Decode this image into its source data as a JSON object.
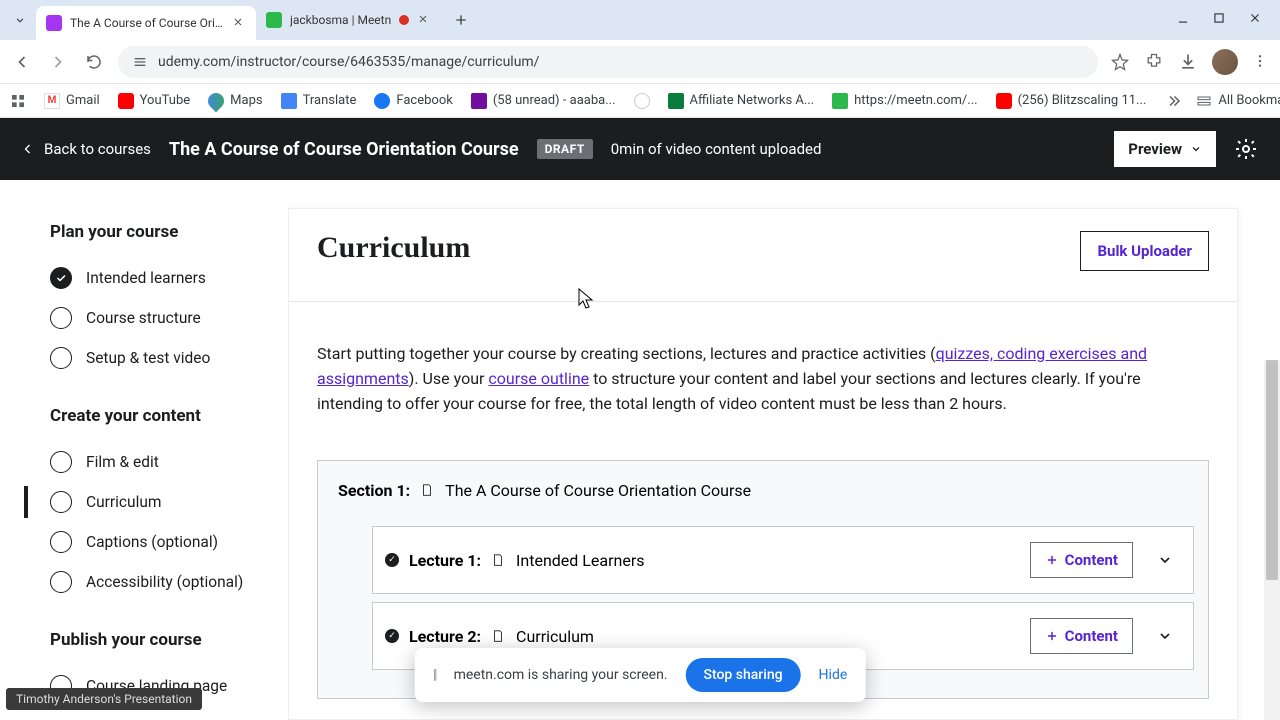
{
  "browser": {
    "tabs": [
      {
        "title": "The A Course of Course Orienta",
        "favicon_color": "#a435f0"
      },
      {
        "title": "jackbosma | Meetn",
        "favicon_color": "#2db84c"
      }
    ],
    "url": "udemy.com/instructor/course/6463535/manage/curriculum/"
  },
  "bookmarks": {
    "items": [
      {
        "label": "Gmail",
        "icon_bg": "#ea4335"
      },
      {
        "label": "YouTube",
        "icon_bg": "#ff0000"
      },
      {
        "label": "Maps",
        "icon_bg": "#34a853"
      },
      {
        "label": "Translate",
        "icon_bg": "#4285f4"
      },
      {
        "label": "Facebook",
        "icon_bg": "#1877f2"
      },
      {
        "label": "(58 unread) - aaaba...",
        "icon_bg": "#720e9e"
      },
      {
        "label": "",
        "icon_bg": "#888"
      },
      {
        "label": "Affiliate Networks A...",
        "icon_bg": "#0a7d3e"
      },
      {
        "label": "https://meetn.com/...",
        "icon_bg": "#2db84c"
      },
      {
        "label": "(256) Blitzscaling 11...",
        "icon_bg": "#ff0000"
      }
    ],
    "all_label": "All Bookmarks"
  },
  "header": {
    "back_label": "Back to courses",
    "course_title": "The A Course of Course Orientation Course",
    "badge": "DRAFT",
    "status": "0min of video content uploaded",
    "preview_label": "Preview"
  },
  "sidebar": {
    "group1_heading": "Plan your course",
    "group1_items": [
      {
        "label": "Intended learners",
        "checked": true
      },
      {
        "label": "Course structure",
        "checked": false
      },
      {
        "label": "Setup & test video",
        "checked": false
      }
    ],
    "group2_heading": "Create your content",
    "group2_items": [
      {
        "label": "Film & edit",
        "checked": false
      },
      {
        "label": "Curriculum",
        "checked": false,
        "active": true
      },
      {
        "label": "Captions (optional)",
        "checked": false
      },
      {
        "label": "Accessibility (optional)",
        "checked": false
      }
    ],
    "group3_heading": "Publish your course",
    "group3_items": [
      {
        "label": "Course landing page",
        "checked": false
      }
    ]
  },
  "main": {
    "heading": "Curriculum",
    "bulk_label": "Bulk Uploader",
    "intro_p1a": "Start putting together your course by creating sections, lectures and practice activities (",
    "intro_link1": "quizzes, coding exercises and assignments",
    "intro_p1b": "). Use your ",
    "intro_link2": "course outline",
    "intro_p1c": " to structure your content and label your sections and lectures clearly. If you're intending to offer your course for free, the total length of video content must be less than 2 hours.",
    "section_label": "Section 1:",
    "section_title": "The A Course of Course Orientation Course",
    "lectures": [
      {
        "num": "Lecture 1:",
        "title": "Intended Learners"
      },
      {
        "num": "Lecture 2:",
        "title": "Curriculum"
      }
    ],
    "content_btn_label": "Content"
  },
  "share": {
    "text": "meetn.com is sharing your screen.",
    "stop": "Stop sharing",
    "hide": "Hide"
  },
  "presentation_label": "Timothy Anderson's Presentation"
}
